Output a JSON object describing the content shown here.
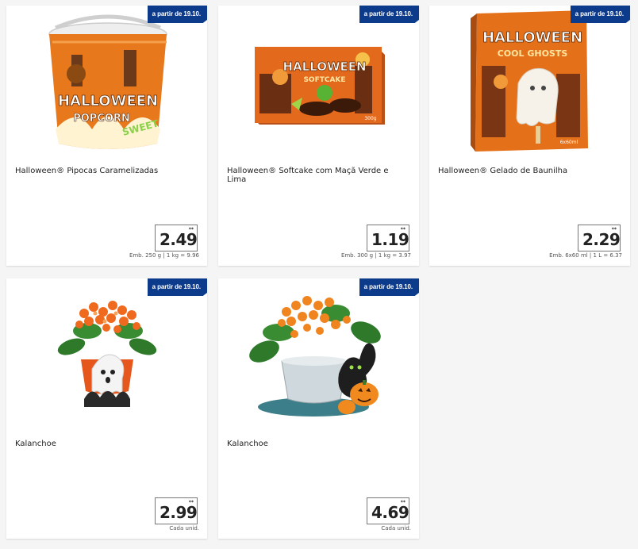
{
  "products": [
    {
      "badge": "a partir de 19.10.",
      "title": "Halloween® Pipocas Caramelizadas",
      "price": "2.49",
      "price_marker": "**",
      "detail": "Emb. 250 g | 1 kg = 9.96",
      "image_icon": "popcorn-bucket-icon"
    },
    {
      "badge": "a partir de 19.10.",
      "title": "Halloween® Softcake com Maçã Verde e Lima",
      "price": "1.19",
      "price_marker": "**",
      "detail": "Emb. 300 g | 1 kg = 3.97",
      "image_icon": "softcake-box-icon"
    },
    {
      "badge": "a partir de 19.10.",
      "title": "Halloween® Gelado de Baunilha",
      "price": "2.29",
      "price_marker": "**",
      "detail": "Emb. 6x60 ml | 1 L = 6.37",
      "image_icon": "icecream-box-icon"
    },
    {
      "badge": "a partir de 19.10.",
      "title": "Kalanchoe",
      "price": "2.99",
      "price_marker": "**",
      "detail": "Cada unid.",
      "image_icon": "kalanchoe-ghost-pot-icon"
    },
    {
      "badge": "a partir de 19.10.",
      "title": "Kalanchoe",
      "price": "4.69",
      "price_marker": "**",
      "detail": "Cada unid.",
      "image_icon": "kalanchoe-cat-pot-icon"
    }
  ],
  "colors": {
    "badge_bg": "#0d3b8c",
    "badge_text": "#ffffff",
    "page_bg": "#f5f5f5",
    "card_bg": "#ffffff",
    "halloween_orange": "#e8701a"
  }
}
